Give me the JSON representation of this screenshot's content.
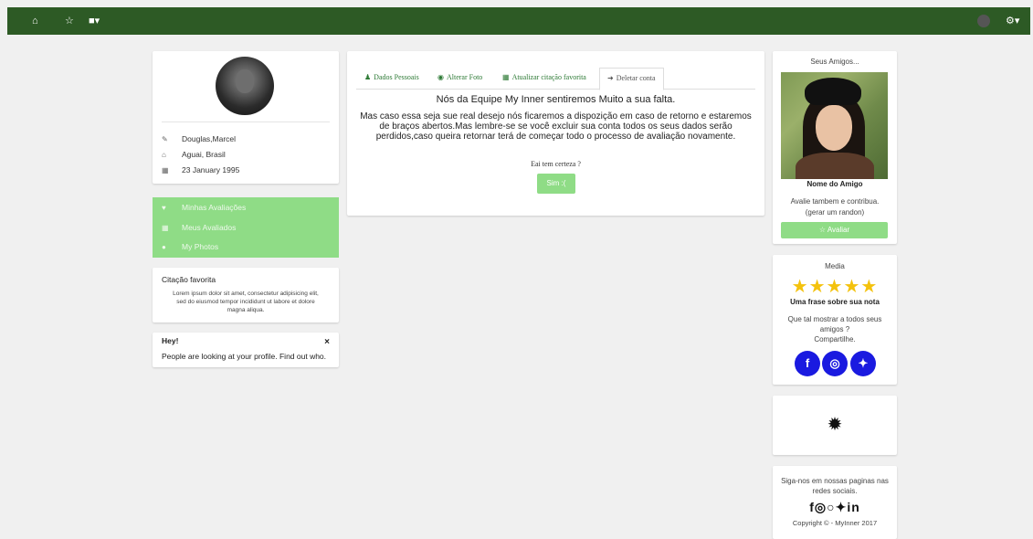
{
  "topbar": {
    "home_icon": "home-icon",
    "star_icon": "star-icon",
    "bell_icon": "bell-icon",
    "avatar": "user-avatar",
    "settings_icon": "gear-icon",
    "color": "#2d5a25"
  },
  "profile": {
    "name": "Douglas,Marcel",
    "location": "Aguai, Brasil",
    "birthday": "23 January 1995"
  },
  "menu": {
    "items": [
      {
        "label": "Minhas Avaliações",
        "icon": "thumbs-up-icon"
      },
      {
        "label": "Meus Avaliados",
        "icon": "calendar-icon"
      },
      {
        "label": "My Photos",
        "icon": "users-icon"
      }
    ],
    "color": "#8fdc86"
  },
  "quote": {
    "title": "Citação favorita",
    "text": "Lorem ipsum dolor sit amet, consectetur adipisicing elit, sed do eiusmod tempor incididunt ut labore et dolore magna aliqua."
  },
  "alert": {
    "title": "Hey!",
    "text": "People are looking at your profile. Find out who.",
    "close": "×"
  },
  "tabs": [
    {
      "label": "Dados Pessoais",
      "icon": "user-icon"
    },
    {
      "label": "Alterar Foto",
      "icon": "camera-icon"
    },
    {
      "label": "Atualizar citação favorita",
      "icon": "file-icon"
    },
    {
      "label": "Deletar conta",
      "icon": "sign-out-icon"
    }
  ],
  "delete": {
    "heading": "Nós da Equipe My Inner sentiremos Muito a sua falta.",
    "body": "Mas caso essa seja sue real desejo nós ficaremos a dispozição em caso de retorno e estaremos de braços abertos.Mas lembre-se se você excluir sua conta todos os seus dados serão perdidos,caso queira retornar terá de começar todo o processo de avaliação novamente.",
    "question": "Eai tem certeza ?",
    "confirm": "Sim :("
  },
  "friends": {
    "title": "Seus Amigos...",
    "name": "Nome do Amigo",
    "desc1": "Avalie tambem e contribua.",
    "desc2": "(gerar um randon)",
    "button": "☆ Avaliar"
  },
  "rating": {
    "title": "Media",
    "stars": 5,
    "headline": "Uma frase sobre sua nota",
    "text1": "Que tal mostrar a todos seus",
    "text2": "amigos ?",
    "text3": "Compartilhe."
  },
  "follow": {
    "text1": "Siga-nos em nossas paginas nas",
    "text2": "redes sociais.",
    "copyright": "Copyright © - MyInner 2017"
  }
}
